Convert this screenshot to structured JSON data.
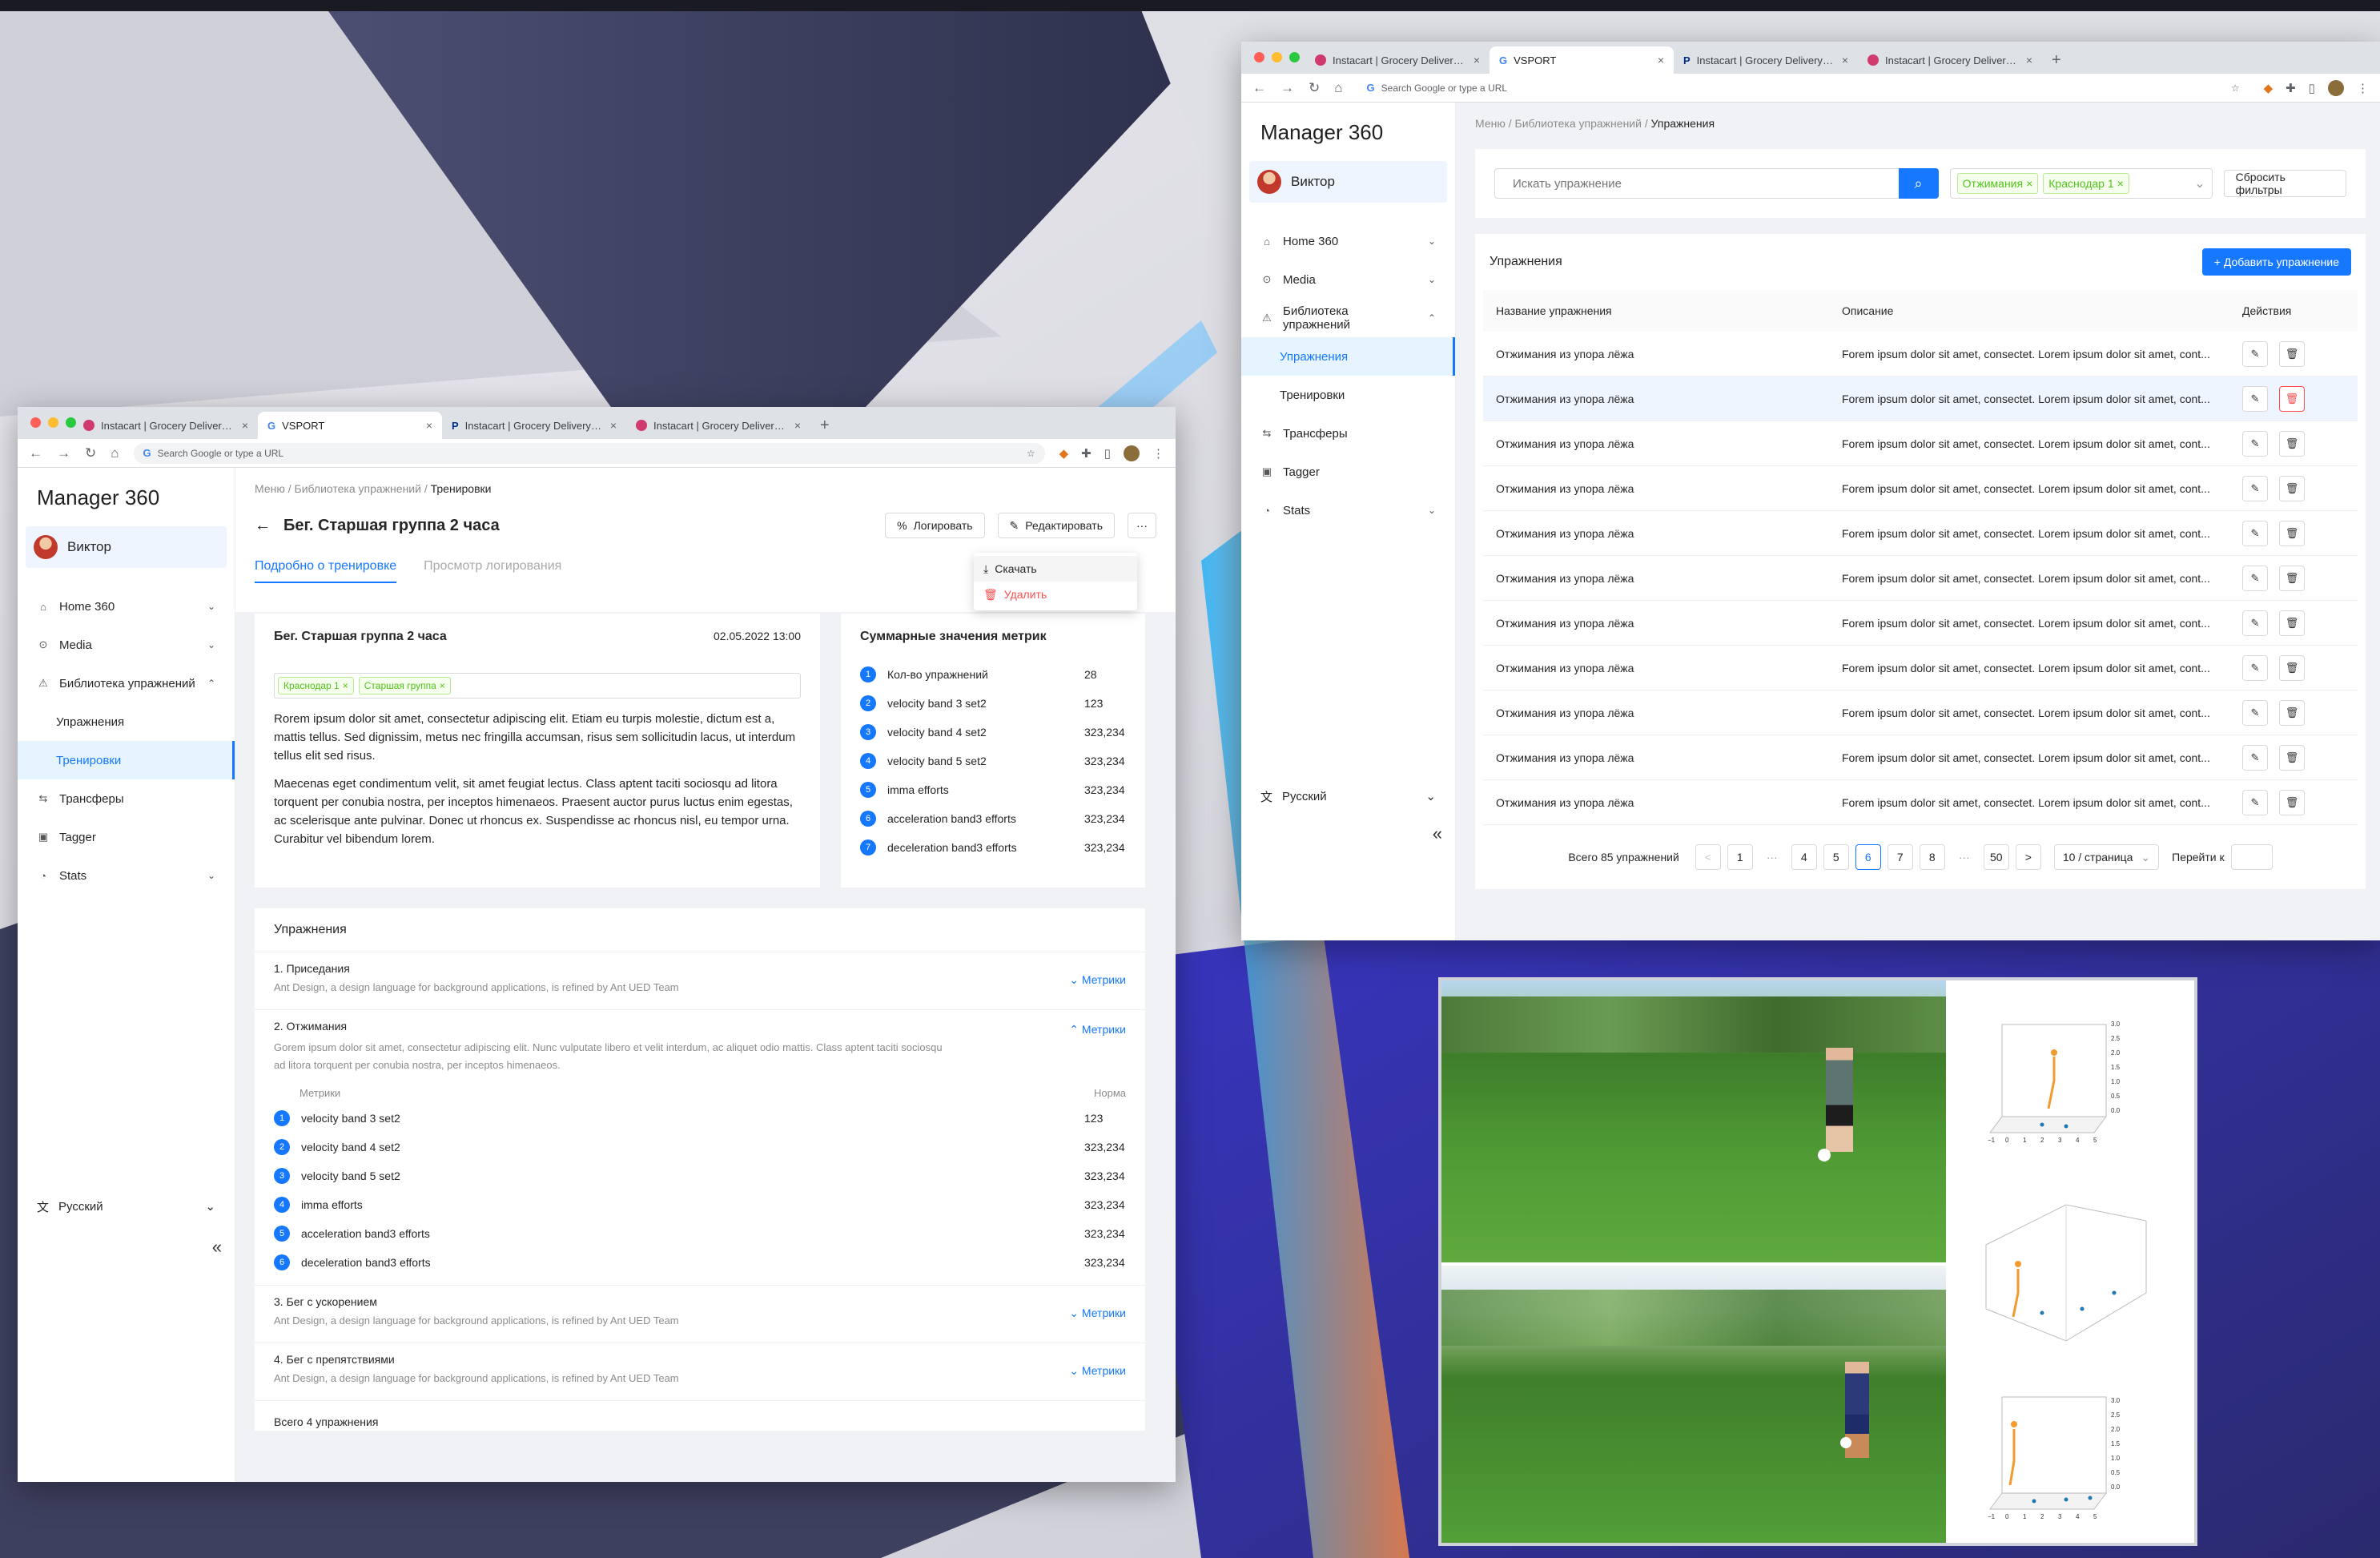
{
  "colors": {
    "accent": "#1677ff",
    "danger": "#ff4d4f",
    "tag_green": "#52c41a"
  },
  "browser": {
    "tabs": [
      "Instacart | Grocery Delivery or...",
      "VSPORT",
      "Instacart | Grocery Delivery or...",
      "Instacart | Grocery Delivery or..."
    ],
    "address_placeholder": "Search Google or type a URL",
    "new_tab": "+",
    "google_g": "G"
  },
  "app": {
    "name": "Manager 360",
    "user": "Виктор",
    "lang": "Русский",
    "collapse": "«"
  },
  "nav": {
    "home": "Home 360",
    "media": "Media",
    "library": "Библиотека упражнений",
    "exercises": "Упражнения",
    "trainings": "Тренировки",
    "transfers": "Трансферы",
    "tagger": "Tagger",
    "stats": "Stats"
  },
  "left": {
    "breadcrumb": [
      "Меню",
      "Библиотека упражнений",
      "Тренировки"
    ],
    "title": "Бег. Старшая группа 2 часа",
    "btn_log": "Логировать",
    "btn_edit": "Редактировать",
    "btn_more": "···",
    "tabs": [
      "Подробно о тренировке",
      "Просмотр логирования"
    ],
    "dropdown": {
      "download": "Скачать",
      "delete": "Удалить"
    },
    "info": {
      "title": "Бег. Старшая группа 2 часа",
      "date": "02.05.2022 13:00",
      "tags": [
        "Краснодар 1",
        "Старшая группа"
      ],
      "p1": "Rorem ipsum dolor sit amet, consectetur adipiscing elit. Etiam eu turpis molestie, dictum est a, mattis tellus. Sed dignissim, metus nec fringilla accumsan, risus sem sollicitudin lacus, ut interdum tellus elit sed risus.",
      "p2": "Maecenas eget condimentum velit, sit amet feugiat lectus. Class aptent taciti sociosqu ad litora torquent per conubia nostra, per inceptos himenaeos. Praesent auctor purus luctus enim egestas, ac scelerisque ante pulvinar. Donec ut rhoncus ex. Suspendisse ac rhoncus nisl, eu tempor urna. Curabitur vel bibendum lorem."
    },
    "summary": {
      "title": "Суммарные значения метрик",
      "rows": [
        {
          "n": "1",
          "label": "Кол-во упражнений",
          "value": "28"
        },
        {
          "n": "2",
          "label": "velocity band 3 set2",
          "value": "123"
        },
        {
          "n": "3",
          "label": "velocity band 4 set2",
          "value": "323,234"
        },
        {
          "n": "4",
          "label": "velocity band 5 set2",
          "value": "323,234"
        },
        {
          "n": "5",
          "label": "imma efforts",
          "value": "323,234"
        },
        {
          "n": "6",
          "label": "acceleration band3 efforts",
          "value": "323,234"
        },
        {
          "n": "7",
          "label": "deceleration band3 efforts",
          "value": "323,234"
        }
      ]
    },
    "exercises": {
      "title": "Упражнения",
      "metrics_link": "Метрики",
      "items": [
        {
          "name": "1. Приседания",
          "desc": "Ant Design, a design language for background applications, is refined by Ant UED Team"
        },
        {
          "name": "2. Отжимания",
          "desc": "Gorem ipsum dolor sit amet, consectetur adipiscing elit. Nunc vulputate libero et velit interdum, ac aliquet odio mattis. Class aptent taciti sociosqu ad litora torquent per conubia nostra, per inceptos himenaeos."
        },
        {
          "name": "3. Бег с ускорением",
          "desc": "Ant Design, a design language for background applications, is refined by Ant UED Team"
        },
        {
          "name": "4. Бег с препятствиями",
          "desc": "Ant Design, a design language for background applications, is refined by Ant UED Team"
        }
      ],
      "metrics_header": "Метрики",
      "norm_header": "Норма",
      "metrics": [
        {
          "n": "1",
          "label": "velocity band 3 set2",
          "value": "123"
        },
        {
          "n": "2",
          "label": "velocity band 4 set2",
          "value": "323,234"
        },
        {
          "n": "3",
          "label": "velocity band 5 set2",
          "value": "323,234"
        },
        {
          "n": "4",
          "label": "imma efforts",
          "value": "323,234"
        },
        {
          "n": "5",
          "label": "acceleration band3 efforts",
          "value": "323,234"
        },
        {
          "n": "6",
          "label": "deceleration band3 efforts",
          "value": "323,234"
        }
      ],
      "total": "Всего 4 упражнения"
    }
  },
  "right": {
    "breadcrumb": [
      "Меню",
      "Библиотека упражнений",
      "Упражнения"
    ],
    "search_placeholder": "Искать упражнение",
    "filter_tags": [
      "Отжимания",
      "Краснодар 1"
    ],
    "reset_filters": "Сбросить фильтры",
    "list_title": "Упражнения",
    "add_button": "+ Добавить упражнение",
    "columns": [
      "Название упражнения",
      "Описание",
      "Действия"
    ],
    "rows": [
      {
        "name": "Отжимания из упора лёжа",
        "desc": "Forem ipsum dolor sit amet, consectet. Lorem ipsum dolor sit amet, cont..."
      },
      {
        "name": "Отжимания из упора лёжа",
        "desc": "Forem ipsum dolor sit amet, consectet. Lorem ipsum dolor sit amet, cont..."
      },
      {
        "name": "Отжимания из упора лёжа",
        "desc": "Forem ipsum dolor sit amet, consectet. Lorem ipsum dolor sit amet, cont..."
      },
      {
        "name": "Отжимания из упора лёжа",
        "desc": "Forem ipsum dolor sit amet, consectet. Lorem ipsum dolor sit amet, cont..."
      },
      {
        "name": "Отжимания из упора лёжа",
        "desc": "Forem ipsum dolor sit amet, consectet. Lorem ipsum dolor sit amet, cont..."
      },
      {
        "name": "Отжимания из упора лёжа",
        "desc": "Forem ipsum dolor sit amet, consectet. Lorem ipsum dolor sit amet, cont..."
      },
      {
        "name": "Отжимания из упора лёжа",
        "desc": "Forem ipsum dolor sit amet, consectet. Lorem ipsum dolor sit amet, cont..."
      },
      {
        "name": "Отжимания из упора лёжа",
        "desc": "Forem ipsum dolor sit amet, consectet. Lorem ipsum dolor sit amet, cont..."
      },
      {
        "name": "Отжимания из упора лёжа",
        "desc": "Forem ipsum dolor sit amet, consectet. Lorem ipsum dolor sit amet, cont..."
      },
      {
        "name": "Отжимания из упора лёжа",
        "desc": "Forem ipsum dolor sit amet, consectet. Lorem ipsum dolor sit amet, cont..."
      },
      {
        "name": "Отжимания из упора лёжа",
        "desc": "Forem ipsum dolor sit amet, consectet. Lorem ipsum dolor sit amet, cont..."
      }
    ],
    "pagination": {
      "total": "Всего 85 упражнений",
      "prev": "<",
      "next": ">",
      "pages": [
        "1",
        "···",
        "4",
        "5",
        "6",
        "7",
        "8",
        "···",
        "50"
      ],
      "current": "6",
      "page_size": "10 / страница",
      "goto": "Перейти к"
    }
  },
  "photo": {
    "plot_ticks_x": [
      "−1",
      "0",
      "1",
      "2",
      "3",
      "4",
      "5"
    ],
    "plot_ticks_y": [
      "3.0",
      "2.5",
      "2.0",
      "1.5",
      "1.0",
      "0.5",
      "0.0"
    ]
  }
}
